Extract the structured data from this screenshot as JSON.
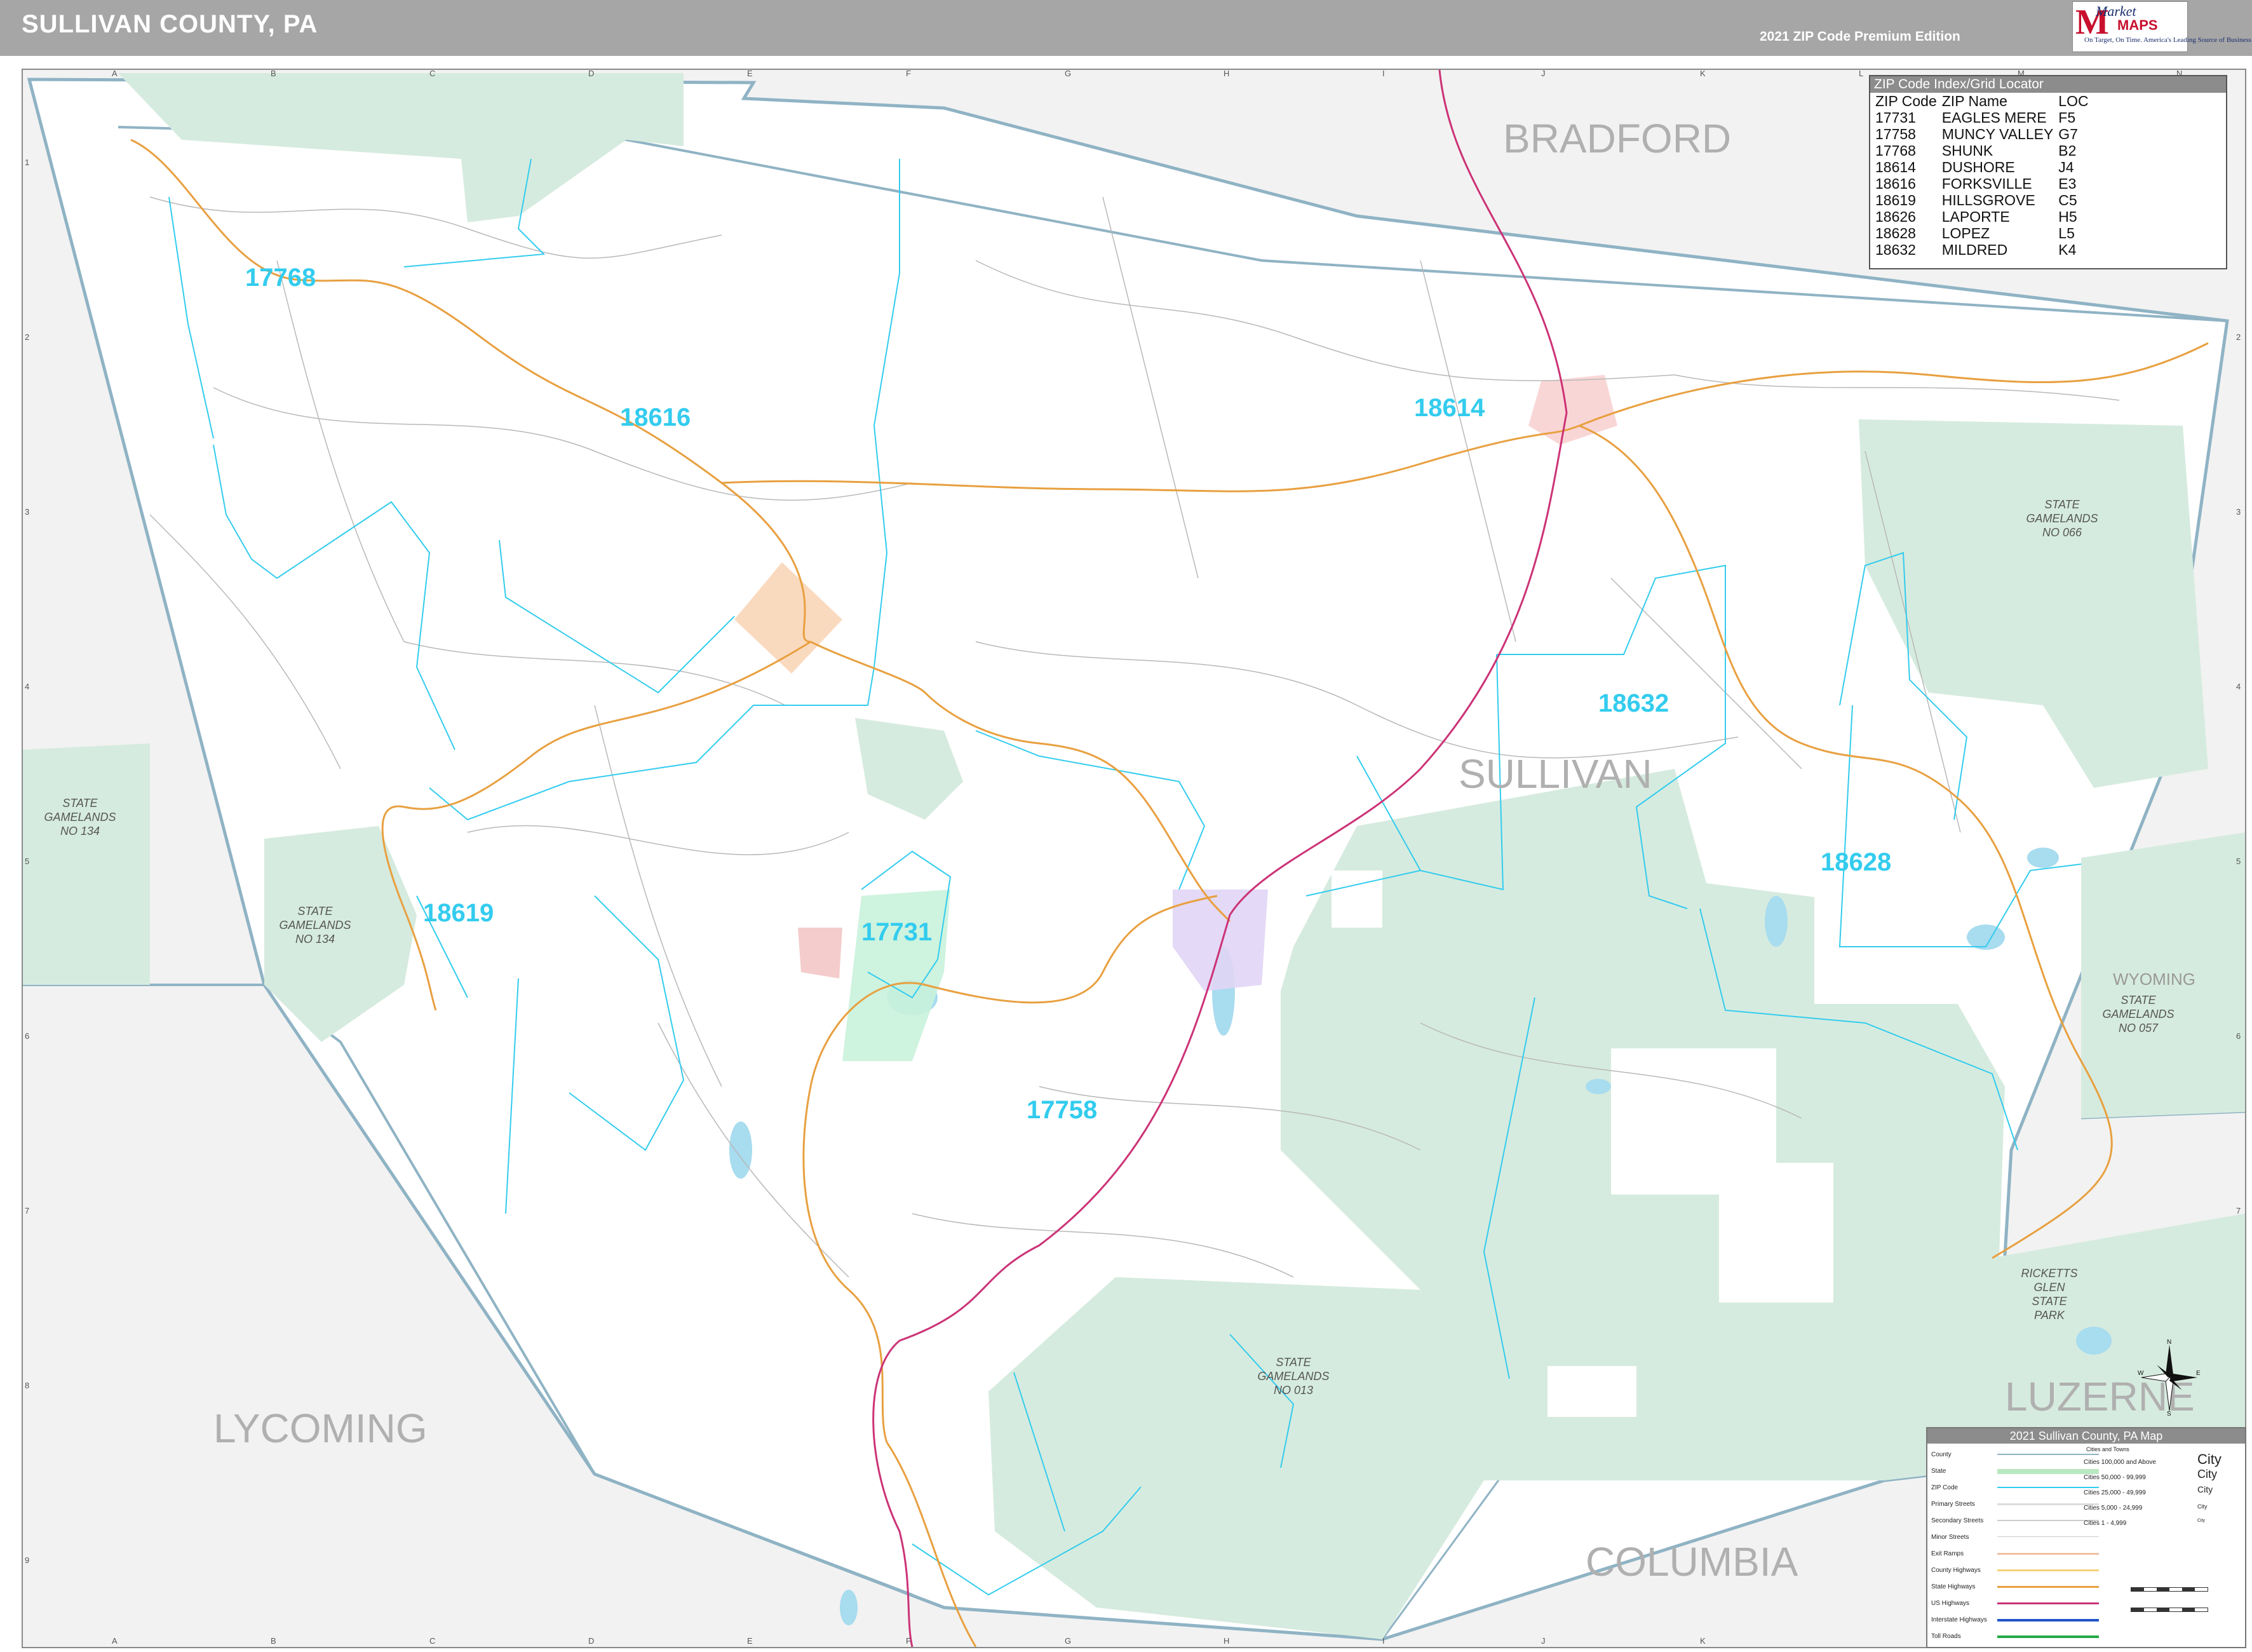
{
  "header": {
    "title": "SULLIVAN COUNTY, PA",
    "edition": "2021 ZIP Code Premium Edition",
    "logo": {
      "brand_top": "Market",
      "brand_bottom": "MAPS",
      "tagline": "On Target, On Time. America's Leading Source of Business Maps"
    }
  },
  "grid": {
    "letters": [
      "A",
      "B",
      "C",
      "D",
      "E",
      "F",
      "G",
      "H",
      "I",
      "J",
      "K",
      "L",
      "M",
      "N"
    ],
    "numbers": [
      "1",
      "2",
      "3",
      "4",
      "5",
      "6",
      "7",
      "8",
      "9"
    ]
  },
  "counties": {
    "bradford": "BRADFORD",
    "sullivan": "SULLIVAN",
    "lycoming": "LYCOMING",
    "columbia": "COLUMBIA",
    "luzerne": "LUZERNE",
    "wyoming": "WYOMING"
  },
  "zip_labels": {
    "z17768": "17768",
    "z18616": "18616",
    "z18614": "18614",
    "z18632": "18632",
    "z18628": "18628",
    "z18619": "18619",
    "z17731": "17731",
    "z17758": "17758"
  },
  "gamelands": {
    "g066": [
      "STATE",
      "GAMELANDS",
      "NO 066"
    ],
    "g134a": [
      "STATE",
      "GAMELANDS",
      "NO 134"
    ],
    "g134b": [
      "STATE",
      "GAMELANDS",
      "NO 134"
    ],
    "g057": [
      "STATE",
      "GAMELANDS",
      "NO 057"
    ],
    "g013": [
      "STATE",
      "GAMELANDS",
      "NO 013"
    ],
    "ricketts": [
      "RICKETTS",
      "GLEN",
      "STATE",
      "PARK"
    ]
  },
  "zip_index": {
    "title": "ZIP Code Index/Grid Locator",
    "headers": [
      "ZIP Code",
      "ZIP Name",
      "LOC"
    ],
    "rows": [
      [
        "17731",
        "EAGLES MERE",
        "F5"
      ],
      [
        "17758",
        "MUNCY VALLEY",
        "G7"
      ],
      [
        "17768",
        "SHUNK",
        "B2"
      ],
      [
        "18614",
        "DUSHORE",
        "J4"
      ],
      [
        "18616",
        "FORKSVILLE",
        "E3"
      ],
      [
        "18619",
        "HILLSGROVE",
        "C5"
      ],
      [
        "18626",
        "LAPORTE",
        "H5"
      ],
      [
        "18628",
        "LOPEZ",
        "L5"
      ],
      [
        "18632",
        "MILDRED",
        "K4"
      ]
    ]
  },
  "legend": {
    "title": "2021 Sullivan County, PA Map",
    "items": [
      "County",
      "State",
      "ZIP Code",
      "Primary Streets",
      "Secondary Streets",
      "Minor Streets",
      "Exit Ramps",
      "County Highways",
      "State Highways",
      "US Highways",
      "Interstate Highways",
      "Toll Roads"
    ],
    "cities_title": "Cities and Towns",
    "cities": [
      "Cities 100,000 and Above",
      "Cities 50,000 - 99,999",
      "Cities 25,000 - 49,999",
      "Cities 5,000 - 24,999",
      "Cities 1 - 4,999"
    ],
    "city_samples": [
      "City",
      "City",
      "City",
      "City",
      "City"
    ]
  },
  "compass": {
    "n": "N",
    "s": "S",
    "e": "E",
    "w": "W"
  },
  "colors": {
    "header": "#a6a6a6",
    "gamelands": "#d6ebdf",
    "zip_boundary": "#33ccee",
    "state_highway": "#e8a040",
    "us_highway": "#cc3377",
    "outside": "#f2f2f2",
    "county_line": "#8fb3c4"
  }
}
